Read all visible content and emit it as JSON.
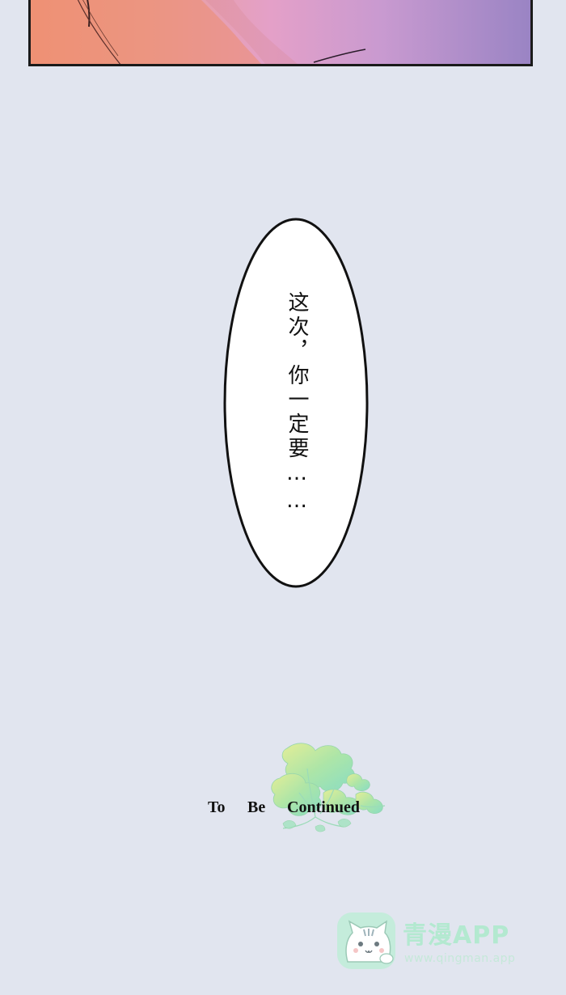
{
  "panel": {
    "image": "comic-panel-bottom-edge"
  },
  "speech_bubble": {
    "text": "这次，你一定要……"
  },
  "end_card": {
    "word_to": "To",
    "word_be": "Be",
    "word_continued": "Continued",
    "decoration": "green-leaf-sprig"
  },
  "watermark": {
    "title": "青漫APP",
    "url": "www.qingman.app",
    "logo_icon": "cat-face-icon"
  },
  "colors": {
    "background": "#e1e5ef",
    "panel_left": "#f2977a",
    "panel_right": "#9a84c4",
    "leaf_green": "#a6e39a",
    "watermark_green": "#b3e9d0"
  }
}
